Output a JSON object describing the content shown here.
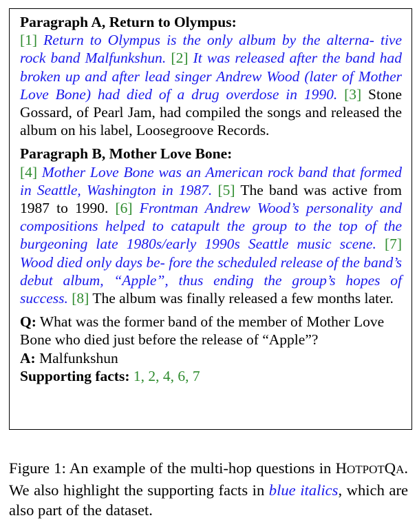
{
  "figure_box": {
    "paragraph_a": {
      "heading": "Paragraph A, Return to Olympus:",
      "sentences": [
        {
          "num": "[1]",
          "text": "Return to Olympus is the only album by the alterna- tive rock band Malfunkshun.",
          "supporting": true
        },
        {
          "num": "[2]",
          "text": "It was released after the band had broken up and after lead singer Andrew Wood (later of Mother Love Bone) had died of a drug overdose in 1990.",
          "supporting": true
        },
        {
          "num": "[3]",
          "text": "Stone Gossard, of Pearl Jam, had compiled the songs and released the album on his label, Loosegroove Records.",
          "supporting": false
        }
      ]
    },
    "paragraph_b": {
      "heading": "Paragraph B, Mother Love Bone:",
      "sentences": [
        {
          "num": "[4]",
          "text": "Mother Love Bone was an American rock band that formed in Seattle, Washington in 1987.",
          "supporting": true
        },
        {
          "num": "[5]",
          "text": "The band was active from 1987 to 1990.",
          "supporting": false
        },
        {
          "num": "[6]",
          "text": "Frontman Andrew Wood’s personality and compositions helped to catapult the group to the top of the burgeoning late 1980s/early 1990s Seattle music scene.",
          "supporting": true
        },
        {
          "num": "[7]",
          "text": "Wood died only days be- fore the scheduled release of the band’s debut album, “Apple”, thus ending the group’s hopes of success.",
          "supporting": true
        },
        {
          "num": "[8]",
          "text": "The album was finally released a few months later.",
          "supporting": false
        }
      ]
    },
    "qa": {
      "q_label": "Q:",
      "question": "What was the former band of the member of Mother Love Bone who died just before the release of “Apple”?",
      "a_label": "A:",
      "answer": "Malfunkshun",
      "sf_label": "Supporting facts:",
      "supporting_facts": "1, 2, 4, 6, 7"
    }
  },
  "caption": {
    "prefix": "Figure 1:  An example of the multi-hop questions in",
    "sc_h": "H",
    "sc_otpot": "OTPOT",
    "sc_q": "Q",
    "sc_a": "A",
    "mid": ". We also highlight the supporting facts in",
    "highlight": "blue italics",
    "suffix": ", which are also part of the dataset."
  },
  "colors": {
    "supporting_text": "#1a1aeb",
    "sentence_number": "#2e8b2e",
    "border": "#000000"
  }
}
